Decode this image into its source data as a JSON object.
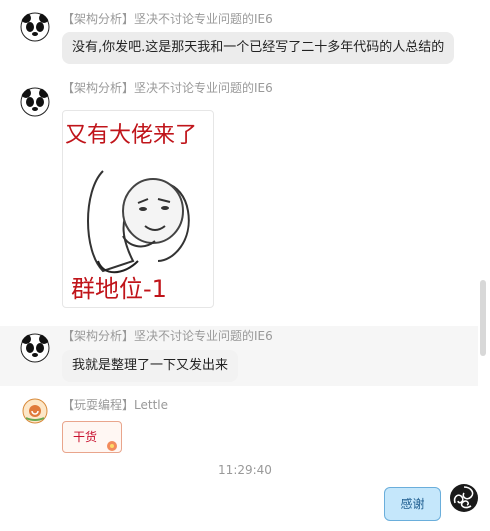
{
  "messages": [
    {
      "sender": "【架构分析】坚决不讨论专业问题的IE6",
      "text": "没有,你发吧.这是那天我和一个已经写了二十多年代码的人总结的",
      "avatar_icon": "panda-face-icon"
    },
    {
      "sender": "【架构分析】坚决不讨论专业问题的IE6",
      "sticker_top": "又有大佬来了",
      "sticker_bottom": "群地位-1",
      "avatar_icon": "panda-face-icon"
    },
    {
      "sender": "【架构分析】坚决不讨论专业问题的IE6",
      "text": "我就是整理了一下又发出来",
      "avatar_icon": "panda-face-icon"
    },
    {
      "sender": "【玩耍编程】Lettle",
      "text": "干货",
      "avatar_icon": "snail-icon"
    }
  ],
  "timestamp": "11:29:40",
  "self_message": {
    "text": "感谢",
    "avatar_icon": "swirl-icon"
  },
  "colors": {
    "bubble_bg": "#ececec",
    "ganhuo_text": "#c8102e",
    "thanks_bg": "#c5e7fb",
    "sticker_text": "#c0141a"
  }
}
